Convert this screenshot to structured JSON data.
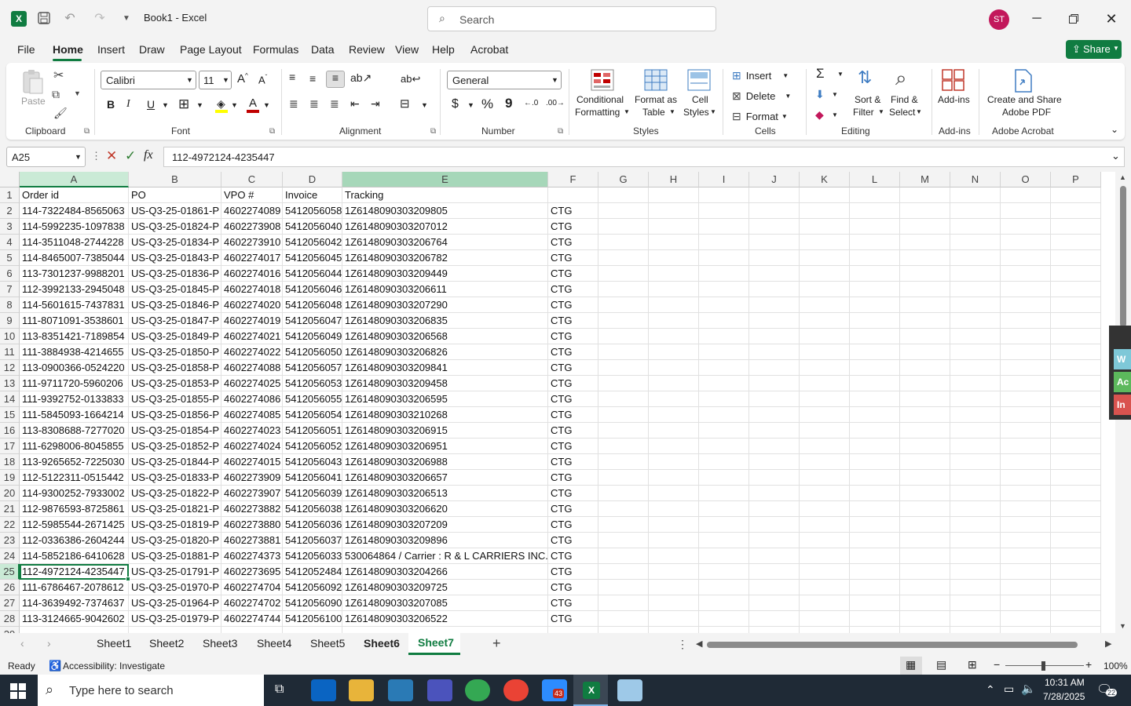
{
  "window": {
    "title": "Book1  -  Excel",
    "search_placeholder": "Search",
    "user_initials": "ST"
  },
  "menu": {
    "tabs": [
      "File",
      "Home",
      "Insert",
      "Draw",
      "Page Layout",
      "Formulas",
      "Data",
      "Review",
      "View",
      "Help",
      "Acrobat"
    ],
    "active": "Home",
    "share_label": "Share"
  },
  "ribbon": {
    "clipboard": {
      "paste": "Paste",
      "label": "Clipboard"
    },
    "font": {
      "name": "Calibri",
      "size": "11",
      "label": "Font",
      "bold": "B",
      "italic": "I",
      "underline": "U"
    },
    "alignment": {
      "label": "Alignment"
    },
    "number": {
      "format": "General",
      "currency": "$",
      "percent": "%",
      "comma": "9",
      "label": "Number"
    },
    "styles": {
      "conditional": [
        "Conditional",
        "Formatting"
      ],
      "format_table": [
        "Format as",
        "Table"
      ],
      "cell_styles": [
        "Cell",
        "Styles"
      ],
      "label": "Styles"
    },
    "cells": {
      "insert": "Insert",
      "delete": "Delete",
      "format": "Format",
      "label": "Cells"
    },
    "editing": {
      "sort": [
        "Sort &",
        "Filter"
      ],
      "find": [
        "Find &",
        "Select"
      ],
      "label": "Editing"
    },
    "addins": {
      "btn": "Add-ins",
      "label": "Add-ins"
    },
    "acrobat": {
      "btn": [
        "Create and Share",
        "Adobe PDF"
      ],
      "label": "Adobe Acrobat"
    }
  },
  "formula_bar": {
    "name_box": "A25",
    "fx": "fx",
    "value": "112-4972124-4235447"
  },
  "grid": {
    "columns": [
      "A",
      "B",
      "C",
      "D",
      "E",
      "F",
      "G",
      "H",
      "I",
      "J",
      "K",
      "L",
      "M",
      "N",
      "O",
      "P"
    ],
    "selected_cell": "A25",
    "rows": [
      [
        "Order id",
        "PO",
        "VPO #",
        "Invoice",
        "Tracking",
        ""
      ],
      [
        "114-7322484-8565063",
        "US-Q3-25-01861-P",
        "4602274089",
        "5412056058",
        "1Z6148090303209805",
        "CTG"
      ],
      [
        "114-5992235-1097838",
        "US-Q3-25-01824-P",
        "4602273908",
        "5412056040",
        "1Z6148090303207012",
        "CTG"
      ],
      [
        "114-3511048-2744228",
        "US-Q3-25-01834-P",
        "4602273910",
        "5412056042",
        "1Z6148090303206764",
        "CTG"
      ],
      [
        "114-8465007-7385044",
        "US-Q3-25-01843-P",
        "4602274017",
        "5412056045",
        "1Z6148090303206782",
        "CTG"
      ],
      [
        "113-7301237-9988201",
        "US-Q3-25-01836-P",
        "4602274016",
        "5412056044",
        "1Z6148090303209449",
        "CTG"
      ],
      [
        "112-3992133-2945048",
        "US-Q3-25-01845-P",
        "4602274018",
        "5412056046",
        "1Z6148090303206611",
        "CTG"
      ],
      [
        "114-5601615-7437831",
        "US-Q3-25-01846-P",
        "4602274020",
        "5412056048",
        "1Z6148090303207290",
        "CTG"
      ],
      [
        "111-8071091-3538601",
        "US-Q3-25-01847-P",
        "4602274019",
        "5412056047",
        "1Z6148090303206835",
        "CTG"
      ],
      [
        "113-8351421-7189854",
        "US-Q3-25-01849-P",
        "4602274021",
        "5412056049",
        "1Z6148090303206568",
        "CTG"
      ],
      [
        "111-3884938-4214655",
        "US-Q3-25-01850-P",
        "4602274022",
        "5412056050",
        "1Z6148090303206826",
        "CTG"
      ],
      [
        "113-0900366-0524220",
        "US-Q3-25-01858-P",
        "4602274088",
        "5412056057",
        "1Z6148090303209841",
        "CTG"
      ],
      [
        "111-9711720-5960206",
        "US-Q3-25-01853-P",
        "4602274025",
        "5412056053",
        "1Z6148090303209458",
        "CTG"
      ],
      [
        "111-9392752-0133833",
        "US-Q3-25-01855-P",
        "4602274086",
        "5412056055",
        "1Z6148090303206595",
        "CTG"
      ],
      [
        "111-5845093-1664214",
        "US-Q3-25-01856-P",
        "4602274085",
        "5412056054",
        "1Z6148090303210268",
        "CTG"
      ],
      [
        "113-8308688-7277020",
        "US-Q3-25-01854-P",
        "4602274023",
        "5412056051",
        "1Z6148090303206915",
        "CTG"
      ],
      [
        "111-6298006-8045855",
        "US-Q3-25-01852-P",
        "4602274024",
        "5412056052",
        "1Z6148090303206951",
        "CTG"
      ],
      [
        "113-9265652-7225030",
        "US-Q3-25-01844-P",
        "4602274015",
        "5412056043",
        "1Z6148090303206988",
        "CTG"
      ],
      [
        "112-5122311-0515442",
        "US-Q3-25-01833-P",
        "4602273909",
        "5412056041",
        "1Z6148090303206657",
        "CTG"
      ],
      [
        "114-9300252-7933002",
        "US-Q3-25-01822-P",
        "4602273907",
        "5412056039",
        "1Z6148090303206513",
        "CTG"
      ],
      [
        "112-9876593-8725861",
        "US-Q3-25-01821-P",
        "4602273882",
        "5412056038",
        "1Z6148090303206620",
        "CTG"
      ],
      [
        "112-5985544-2671425",
        "US-Q3-25-01819-P",
        "4602273880",
        "5412056036",
        "1Z6148090303207209",
        "CTG"
      ],
      [
        "112-0336386-2604244",
        "US-Q3-25-01820-P",
        "4602273881",
        "5412056037",
        "1Z6148090303209896",
        "CTG"
      ],
      [
        "114-5852186-6410628",
        "US-Q3-25-01881-P",
        "4602274373",
        "5412056033",
        "530064864 / Carrier : R & L CARRIERS INC.",
        "CTG"
      ],
      [
        "112-4972124-4235447",
        "US-Q3-25-01791-P",
        "4602273695",
        "5412052484",
        "1Z6148090303204266",
        "CTG"
      ],
      [
        "111-6786467-2078612",
        "US-Q3-25-01970-P",
        "4602274704",
        "5412056092",
        "1Z6148090303209725",
        "CTG"
      ],
      [
        "114-3639492-7374637",
        "US-Q3-25-01964-P",
        "4602274702",
        "5412056090",
        "1Z6148090303207085",
        "CTG"
      ],
      [
        "113-3124665-9042602",
        "US-Q3-25-01979-P",
        "4602274744",
        "5412056100",
        "1Z6148090303206522",
        "CTG"
      ]
    ]
  },
  "sheets": {
    "tabs": [
      "Sheet1",
      "Sheet2",
      "Sheet3",
      "Sheet4",
      "Sheet5",
      "Sheet6",
      "Sheet7"
    ],
    "active": "Sheet7",
    "add": "+"
  },
  "status": {
    "ready": "Ready",
    "accessibility": "Accessibility: Investigate",
    "zoom": "100%"
  },
  "taskbar": {
    "search_placeholder": "Type here to search",
    "time": "10:31 AM",
    "date": "7/28/2025",
    "notifications": "22",
    "zoom_badge": "43"
  },
  "side_panel": {
    "items": [
      "W",
      "Ac",
      "In"
    ]
  },
  "colors": {
    "excel_green": "#107c41",
    "header_selected": "#caead6",
    "col_selected": "#a6d7b9",
    "accent_red": "#c00000"
  }
}
